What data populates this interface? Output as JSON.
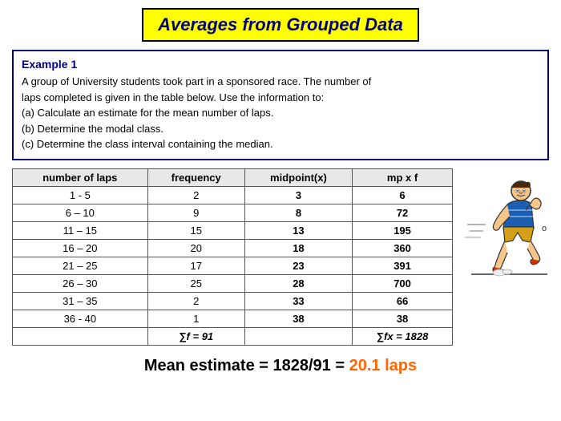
{
  "title": "Averages from Grouped Data",
  "example": {
    "label": "Example 1",
    "lines": [
      "A group of University students took part in a sponsored race. The number of",
      "laps completed is given in the table below. Use the information to:",
      "(a) Calculate an estimate for the mean number of laps.",
      "(b) Determine the modal class.",
      "(c) Determine the class interval containing the median."
    ]
  },
  "table": {
    "headers": [
      "number of laps",
      "frequency",
      "midpoint(x)",
      "mp x f"
    ],
    "rows": [
      {
        "laps": "1 - 5",
        "freq": "2",
        "mid": "3",
        "mpf": "6"
      },
      {
        "laps": "6 – 10",
        "freq": "9",
        "mid": "8",
        "mpf": "72"
      },
      {
        "laps": "11 – 15",
        "freq": "15",
        "mid": "13",
        "mpf": "195"
      },
      {
        "laps": "16 – 20",
        "freq": "20",
        "mid": "18",
        "mpf": "360"
      },
      {
        "laps": "21 – 25",
        "freq": "17",
        "mid": "23",
        "mpf": "391"
      },
      {
        "laps": "26 – 30",
        "freq": "25",
        "mid": "28",
        "mpf": "700"
      },
      {
        "laps": "31 – 35",
        "freq": "2",
        "mid": "33",
        "mpf": "66"
      },
      {
        "laps": "36 - 40",
        "freq": "1",
        "mid": "38",
        "mpf": "38"
      }
    ],
    "sum_row": {
      "freq_label": "∑f = 91",
      "mpf_label": "∑fx = 1828"
    }
  },
  "mean_estimate": {
    "text": "Mean estimate = 1828/91 = ",
    "value": "20.1 laps"
  }
}
